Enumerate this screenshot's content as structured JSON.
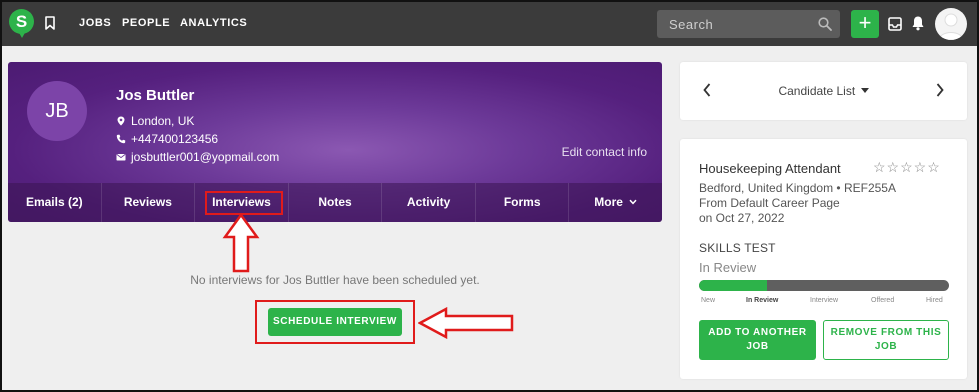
{
  "topbar": {
    "logo_letter": "S",
    "nav": [
      "JOBS",
      "PEOPLE",
      "ANALYTICS"
    ],
    "search_placeholder": "Search",
    "plus": "+"
  },
  "candidate": {
    "initials": "JB",
    "name": "Jos Buttler",
    "location": "London, UK",
    "phone": "+447400123456",
    "email": "josbuttler001@yopmail.com",
    "edit_contact": "Edit contact info"
  },
  "tabs": [
    "Emails (2)",
    "Reviews",
    "Interviews",
    "Notes",
    "Activity",
    "Forms",
    "More"
  ],
  "main": {
    "empty_message": "No interviews for Jos Buttler have been scheduled yet.",
    "schedule_button": "SCHEDULE INTERVIEW"
  },
  "candidate_list": {
    "title": "Candidate List"
  },
  "job": {
    "title": "Housekeeping Attendant",
    "stars": "☆☆☆☆☆",
    "location_ref": "Bedford, United Kingdom  •  REF255A",
    "source": "From Default Career Page",
    "date": "on Oct 27, 2022",
    "stage_title": "SKILLS TEST",
    "status": "In Review",
    "progress": 0.27,
    "stages": [
      "New",
      "In Review",
      "Interview",
      "Offered",
      "Hired"
    ],
    "add_button": "ADD TO ANOTHER JOB",
    "remove_button": "REMOVE FROM THIS JOB"
  },
  "colors": {
    "brand_green": "#2db34a",
    "purple": "#6d3a99",
    "annotation_red": "#e01b1b"
  }
}
